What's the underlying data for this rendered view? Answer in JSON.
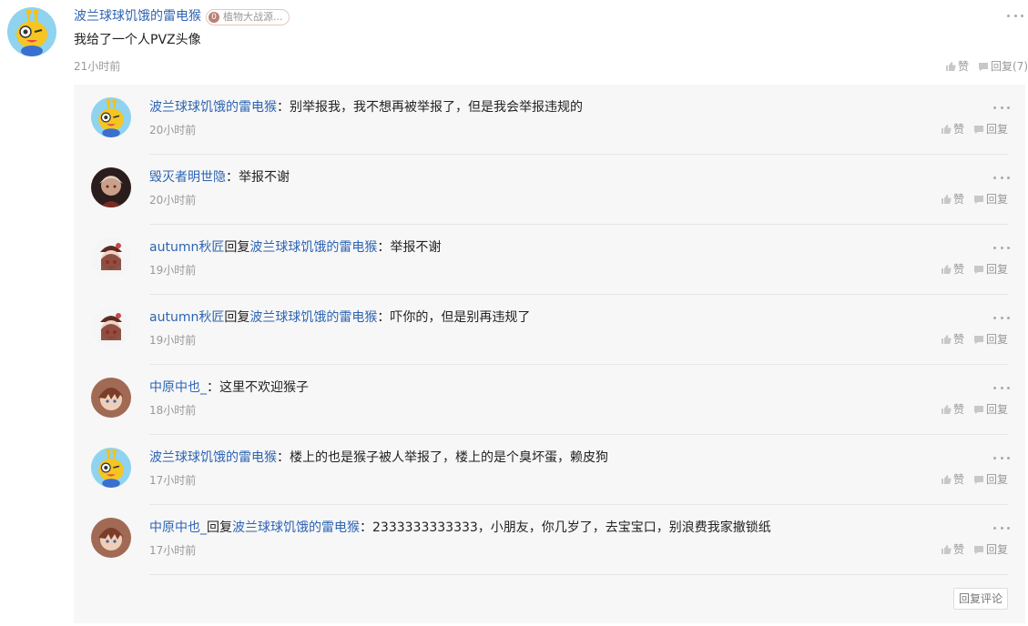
{
  "main": {
    "author": "波兰球球饥饿的雷电猴",
    "badge_level": "0",
    "badge_text": "植物大战源...",
    "text": "我给了一个人PVZ头像",
    "time": "21小时前",
    "like_label": "赞",
    "reply_label": "回复(7)",
    "avatar_icon": "yellow-robot-avatar"
  },
  "replies": [
    {
      "author": "波兰球球饥饿的雷电猴",
      "reply_word": "",
      "target": "",
      "colon": "：",
      "text": "别举报我，我不想再被举报了，但是我会举报违规的",
      "time": "20小时前",
      "like": "赞",
      "reply": "回复",
      "avatar_icon": "yellow-robot-avatar"
    },
    {
      "author": "毁灭者明世隐",
      "reply_word": "",
      "target": "",
      "colon": "：",
      "text": "举报不谢",
      "time": "20小时前",
      "like": "赞",
      "reply": "回复",
      "avatar_icon": "dark-haired-character-avatar"
    },
    {
      "author": "autumn秋匠",
      "reply_word": "回复",
      "target": "波兰球球饥饿的雷电猴",
      "colon": "：",
      "text": "举报不谢",
      "time": "19小时前",
      "like": "赞",
      "reply": "回复",
      "avatar_icon": "hat-girl-avatar"
    },
    {
      "author": "autumn秋匠",
      "reply_word": "回复",
      "target": "波兰球球饥饿的雷电猴",
      "colon": "：",
      "text": "吓你的，但是别再违规了",
      "time": "19小时前",
      "like": "赞",
      "reply": "回复",
      "avatar_icon": "hat-girl-avatar"
    },
    {
      "author": "中原中也_",
      "reply_word": "",
      "target": "",
      "colon": "：",
      "text": "这里不欢迎猴子",
      "time": "18小时前",
      "like": "赞",
      "reply": "回复",
      "avatar_icon": "brown-haired-character-avatar"
    },
    {
      "author": "波兰球球饥饿的雷电猴",
      "reply_word": "",
      "target": "",
      "colon": "：",
      "text": "楼上的也是猴子被人举报了，楼上的是个臭坏蛋，赖皮狗",
      "time": "17小时前",
      "like": "赞",
      "reply": "回复",
      "avatar_icon": "yellow-robot-avatar"
    },
    {
      "author": "中原中也_",
      "reply_word": "回复",
      "target": "波兰球球饥饿的雷电猴",
      "colon": "：",
      "text": "2333333333333，小朋友，你几岁了，去宝宝口，别浪费我家撤锁纸",
      "time": "17小时前",
      "like": "赞",
      "reply": "回复",
      "avatar_icon": "brown-haired-character-avatar"
    }
  ],
  "reply_comment_button": "回复评论",
  "colors": {
    "link": "#2d64b3",
    "muted": "#999999",
    "panel_bg": "#f7f7f7"
  }
}
